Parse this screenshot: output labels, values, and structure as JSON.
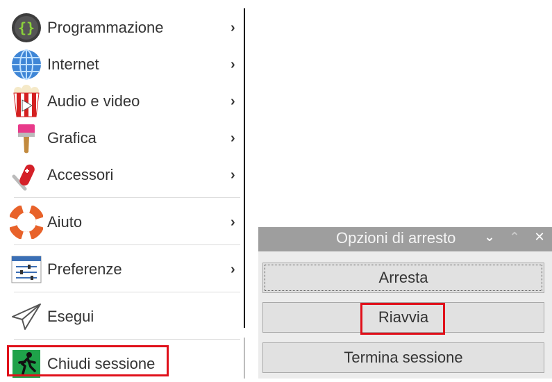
{
  "menu": {
    "items": [
      {
        "label": "Programmazione",
        "icon": "programming-icon",
        "has_submenu": true
      },
      {
        "label": "Internet",
        "icon": "globe-icon",
        "has_submenu": true
      },
      {
        "label": "Audio e video",
        "icon": "popcorn-icon",
        "has_submenu": true
      },
      {
        "label": "Grafica",
        "icon": "paintbrush-icon",
        "has_submenu": true
      },
      {
        "label": "Accessori",
        "icon": "swiss-knife-icon",
        "has_submenu": true
      },
      {
        "label": "Aiuto",
        "icon": "lifebuoy-icon",
        "has_submenu": true
      },
      {
        "label": "Preferenze",
        "icon": "sliders-icon",
        "has_submenu": true
      },
      {
        "label": "Esegui",
        "icon": "paper-plane-icon",
        "has_submenu": false
      },
      {
        "label": "Chiudi sessione",
        "icon": "exit-runner-icon",
        "has_submenu": false
      }
    ],
    "chevron": "›"
  },
  "dialog": {
    "title": "Opzioni di arresto",
    "buttons": {
      "shutdown": "Arresta",
      "reboot": "Riavvia",
      "logout": "Termina sessione"
    },
    "window_controls": {
      "minimize": "⌄",
      "maximize": "⌃",
      "close": "✕"
    }
  },
  "colors": {
    "highlight": "#e0101a",
    "titlebar": "#9e9e9e",
    "button_bg": "#e1e1e1"
  }
}
